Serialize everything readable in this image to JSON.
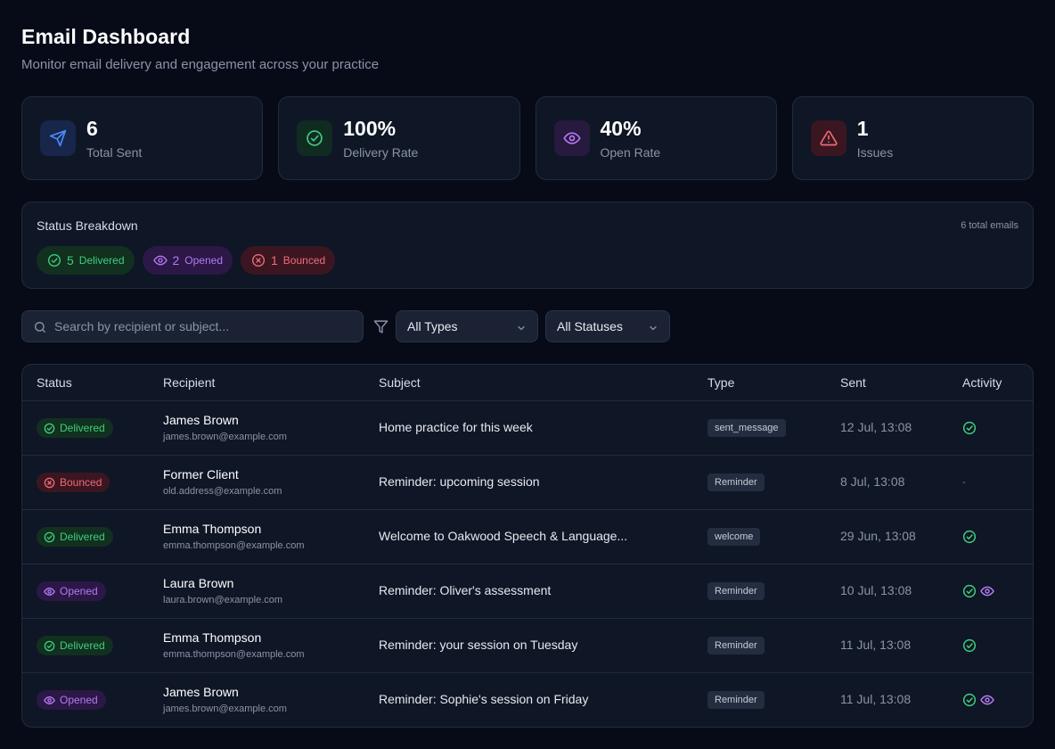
{
  "header": {
    "title": "Email Dashboard",
    "subtitle": "Monitor email delivery and engagement across your practice"
  },
  "stats": [
    {
      "value": "6",
      "label": "Total Sent",
      "icon": "send-icon",
      "color": "#4a8cf7"
    },
    {
      "value": "100%",
      "label": "Delivery Rate",
      "icon": "check-circle-icon",
      "color": "#3fcf7c"
    },
    {
      "value": "40%",
      "label": "Open Rate",
      "icon": "eye-icon",
      "color": "#b57af3"
    },
    {
      "value": "1",
      "label": "Issues",
      "icon": "alert-triangle-icon",
      "color": "#f06a7a"
    }
  ],
  "breakdown": {
    "title": "Status Breakdown",
    "total": "6 total emails",
    "pills": [
      {
        "count": "5",
        "label": "Delivered",
        "icon": "check-circle-icon"
      },
      {
        "count": "2",
        "label": "Opened",
        "icon": "eye-icon"
      },
      {
        "count": "1",
        "label": "Bounced",
        "icon": "x-circle-icon"
      }
    ]
  },
  "filters": {
    "search_placeholder": "Search by recipient or subject...",
    "type_select": "All Types",
    "status_select": "All Statuses"
  },
  "table": {
    "columns": [
      "Status",
      "Recipient",
      "Subject",
      "Type",
      "Sent",
      "Activity"
    ],
    "rows": [
      {
        "status": "Delivered",
        "name": "James Brown",
        "email": "james.brown@example.com",
        "subject": "Home practice for this week",
        "type": "sent_message",
        "sent": "12 Jul, 13:08",
        "activity": [
          "delivered"
        ]
      },
      {
        "status": "Bounced",
        "name": "Former Client",
        "email": "old.address@example.com",
        "subject": "Reminder: upcoming session",
        "type": "Reminder",
        "sent": "8 Jul, 13:08",
        "activity": [],
        "activity_empty": "-"
      },
      {
        "status": "Delivered",
        "name": "Emma Thompson",
        "email": "emma.thompson@example.com",
        "subject": "Welcome to Oakwood Speech & Language...",
        "type": "welcome",
        "sent": "29 Jun, 13:08",
        "activity": [
          "delivered"
        ]
      },
      {
        "status": "Opened",
        "name": "Laura Brown",
        "email": "laura.brown@example.com",
        "subject": "Reminder: Oliver's assessment",
        "type": "Reminder",
        "sent": "10 Jul, 13:08",
        "activity": [
          "delivered",
          "opened"
        ]
      },
      {
        "status": "Delivered",
        "name": "Emma Thompson",
        "email": "emma.thompson@example.com",
        "subject": "Reminder: your session on Tuesday",
        "type": "Reminder",
        "sent": "11 Jul, 13:08",
        "activity": [
          "delivered"
        ]
      },
      {
        "status": "Opened",
        "name": "James Brown",
        "email": "james.brown@example.com",
        "subject": "Reminder: Sophie's session on Friday",
        "type": "Reminder",
        "sent": "11 Jul, 13:08",
        "activity": [
          "delivered",
          "opened"
        ]
      }
    ]
  },
  "colors": {
    "green": "#3fcf7c",
    "red": "#f06a7a",
    "purple": "#b57af3",
    "blue": "#4a8cf7"
  }
}
